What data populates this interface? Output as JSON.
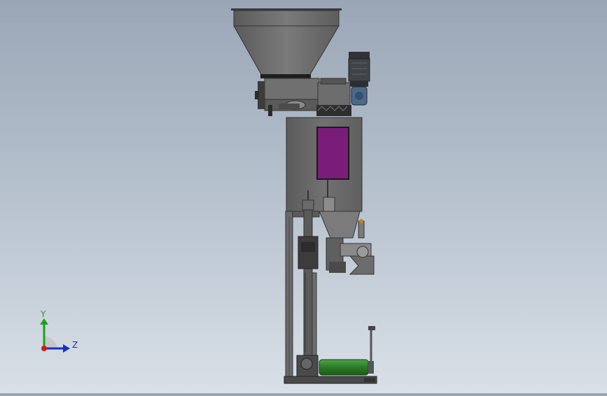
{
  "viewport": {
    "background_top": "#9aa6b6",
    "background_bottom": "#d9e0e7"
  },
  "model": {
    "body_color": "#6b6b6b",
    "frame_color": "#5e5e5e",
    "window_color": "#7a1d7a",
    "conveyor_color": "#2f7a2a",
    "motor_color": "#3a3f44",
    "gearbox_color": "#4a6a8a"
  },
  "triad": {
    "y_label": "Y",
    "z_label": "Z",
    "y_color": "#1aa31a",
    "z_color": "#1a2fc8",
    "x_color": "#d21a1a",
    "arc_color": "#c7c7c7"
  }
}
